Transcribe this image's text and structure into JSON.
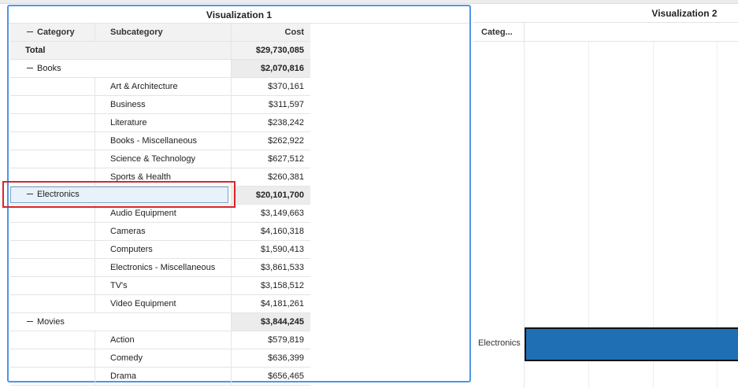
{
  "viz1": {
    "title": "Visualization 1",
    "headers": {
      "category": "Category",
      "subcategory": "Subcategory",
      "cost": "Cost"
    },
    "total": {
      "label": "Total",
      "cost": "$29,730,085"
    },
    "books": {
      "label": "Books",
      "cost": "$2,070,816",
      "rows": [
        {
          "sub": "Art & Architecture",
          "cost": "$370,161"
        },
        {
          "sub": "Business",
          "cost": "$311,597"
        },
        {
          "sub": "Literature",
          "cost": "$238,242"
        },
        {
          "sub": "Books - Miscellaneous",
          "cost": "$262,922"
        },
        {
          "sub": "Science & Technology",
          "cost": "$627,512"
        },
        {
          "sub": "Sports & Health",
          "cost": "$260,381"
        }
      ]
    },
    "electronics": {
      "label": "Electronics",
      "cost": "$20,101,700",
      "rows": [
        {
          "sub": "Audio Equipment",
          "cost": "$3,149,663"
        },
        {
          "sub": "Cameras",
          "cost": "$4,160,318"
        },
        {
          "sub": "Computers",
          "cost": "$1,590,413"
        },
        {
          "sub": "Electronics - Miscellaneous",
          "cost": "$3,861,533"
        },
        {
          "sub": "TV's",
          "cost": "$3,158,512"
        },
        {
          "sub": "Video Equipment",
          "cost": "$4,181,261"
        }
      ]
    },
    "movies": {
      "label": "Movies",
      "cost": "$3,844,245",
      "rows": [
        {
          "sub": "Action",
          "cost": "$579,819"
        },
        {
          "sub": "Comedy",
          "cost": "$636,399"
        },
        {
          "sub": "Drama",
          "cost": "$656,465"
        }
      ]
    }
  },
  "viz2": {
    "title": "Visualization 2",
    "category_header": "Categ...",
    "bar_label": "Electronics",
    "bar_color": "#1f6fb5"
  },
  "colors": {
    "panel_border": "#4f94e6",
    "highlight_border": "#d9252a",
    "selection_fill": "#e8f2fb"
  }
}
